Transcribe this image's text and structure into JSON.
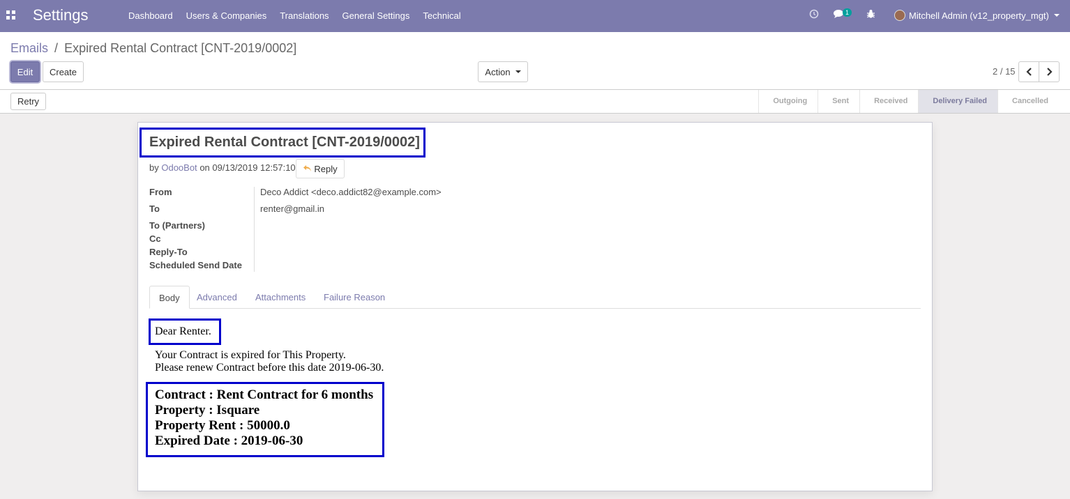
{
  "navbar": {
    "app_title": "Settings",
    "menu": [
      "Dashboard",
      "Users & Companies",
      "Translations",
      "General Settings",
      "Technical"
    ],
    "messages_badge": "1",
    "user_name": "Mitchell Admin (v12_property_mgt)",
    "color": "#7c7bad"
  },
  "breadcrumb": {
    "parent": "Emails",
    "separator": "/",
    "current": "Expired Rental Contract [CNT-2019/0002]"
  },
  "buttons": {
    "edit": "Edit",
    "create": "Create",
    "action": "Action",
    "retry": "Retry"
  },
  "pager": {
    "value": "2 / 15"
  },
  "statusbar": {
    "stages": [
      "Outgoing",
      "Sent",
      "Received",
      "Delivery Failed",
      "Cancelled"
    ],
    "active": "Delivery Failed"
  },
  "message": {
    "subject": "Expired Rental Contract [CNT-2019/0002]",
    "by_prefix": "by",
    "author": "OdooBot",
    "date_text": "on 09/13/2019 12:57:10",
    "reply_label": "Reply",
    "fields": {
      "from_label": "From",
      "from_value": "Deco Addict <deco.addict82@example.com>",
      "to_label": "To",
      "to_value": "renter@gmail.in",
      "to_partners_label": "To (Partners)",
      "cc_label": "Cc",
      "reply_to_label": "Reply-To",
      "scheduled_label": "Scheduled Send Date"
    },
    "tabs": [
      "Body",
      "Advanced",
      "Attachments",
      "Failure Reason"
    ],
    "active_tab": "Body",
    "body": {
      "greeting": "Dear Renter.",
      "line1": "Your Contract is expired for This Property.",
      "line2": "Please renew Contract before this date 2019-06-30.",
      "contract": "Contract : Rent Contract for 6 months",
      "property": "Property : Isquare",
      "rent": "Property Rent : 50000.0",
      "expired": "Expired Date : 2019-06-30"
    }
  }
}
